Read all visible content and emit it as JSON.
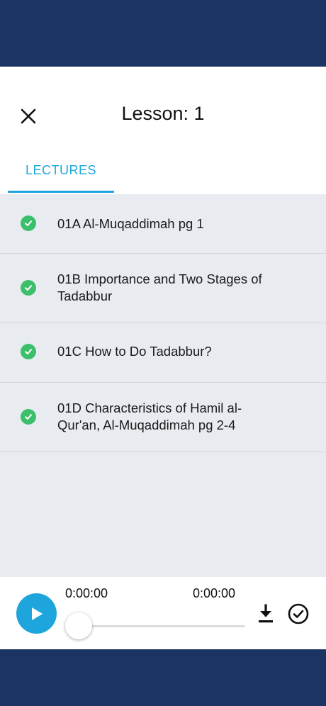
{
  "header": {
    "title": "Lesson: 1",
    "close_icon": "close-icon"
  },
  "tabs": [
    {
      "label": "LECTURES",
      "active": true
    }
  ],
  "lectures": [
    {
      "title": "01A Al-Muqaddimah pg 1",
      "completed": true
    },
    {
      "title": "01B Importance and Two Stages of Tadabbur",
      "completed": true
    },
    {
      "title": "01C How to Do Tadabbur?",
      "completed": true
    },
    {
      "title": "01D Characteristics of Hamil al-Qur'an, Al-Muqaddimah pg 2-4",
      "completed": true
    }
  ],
  "player": {
    "current_time": "0:00:00",
    "total_time": "0:00:00",
    "progress": 0,
    "icons": [
      "play-icon",
      "download-icon",
      "check-circle-icon"
    ]
  },
  "colors": {
    "nav_bar": "#1b3461",
    "accent": "#1ea6dc",
    "check": "#3cbf6a",
    "list_bg": "#e8ebf0"
  }
}
